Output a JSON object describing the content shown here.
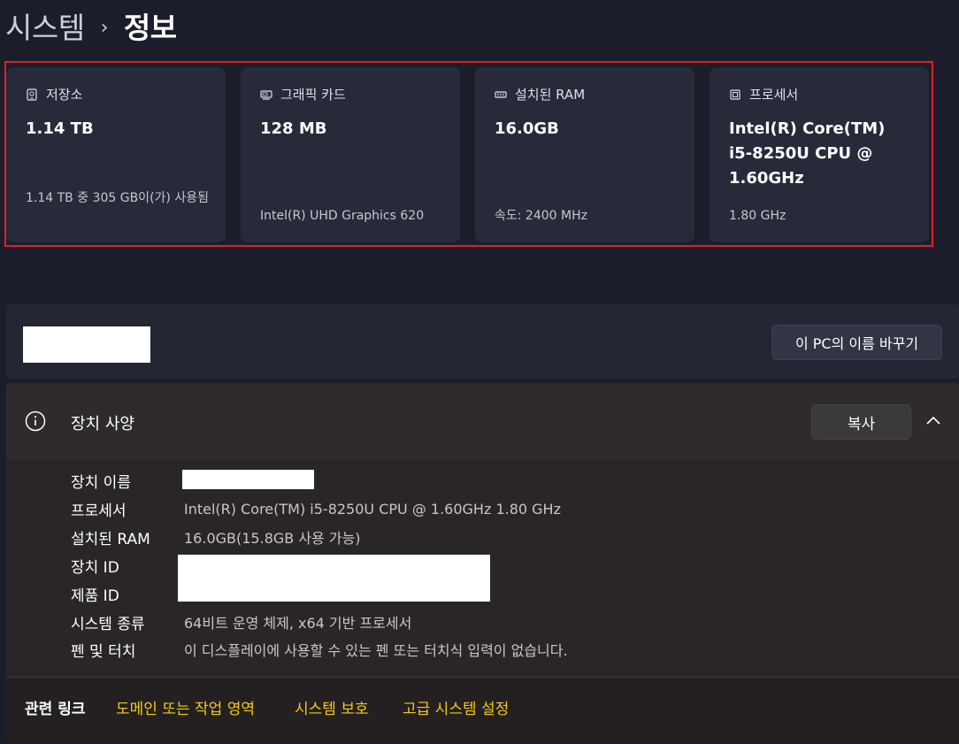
{
  "breadcrumb": {
    "parent": "시스템",
    "separator": "›",
    "current": "정보"
  },
  "cards": [
    {
      "icon": "storage-icon",
      "title": "저장소",
      "value": "1.14 TB",
      "sub": "1.14 TB 중 305 GB이(가) 사용됨"
    },
    {
      "icon": "graphics-card-icon",
      "title": "그래픽 카드",
      "value": "128 MB",
      "sub": "Intel(R) UHD Graphics 620"
    },
    {
      "icon": "ram-icon",
      "title": "설치된 RAM",
      "value": "16.0GB",
      "sub": "속도: 2400 MHz"
    },
    {
      "icon": "processor-icon",
      "title": "프로세서",
      "value": "Intel(R) Core(TM) i5-8250U CPU @ 1.60GHz",
      "sub": "1.80 GHz"
    }
  ],
  "rename": {
    "button_label": "이 PC의 이름 바꾸기"
  },
  "specs": {
    "title": "장치 사양",
    "copy_label": "복사",
    "rows": [
      {
        "label": "장치 이름",
        "value": ""
      },
      {
        "label": "프로세서",
        "value": "Intel(R) Core(TM) i5-8250U CPU @ 1.60GHz   1.80 GHz"
      },
      {
        "label": "설치된 RAM",
        "value": "16.0GB(15.8GB 사용 가능)"
      },
      {
        "label": "장치 ID",
        "value": ""
      },
      {
        "label": "제품 ID",
        "value": ""
      },
      {
        "label": "시스템 종류",
        "value": "64비트 운영 체제, x64 기반 프로세서"
      },
      {
        "label": "펜 및 터치",
        "value": "이 디스플레이에 사용할 수 있는 펜 또는 터치식 입력이 없습니다."
      }
    ]
  },
  "related": {
    "label": "관련 링크",
    "links": [
      "도메인 또는 작업 영역",
      "시스템 보호",
      "고급 시스템 설정"
    ]
  },
  "colors": {
    "highlight_border": "#e0202a",
    "link": "#f2c81f"
  }
}
